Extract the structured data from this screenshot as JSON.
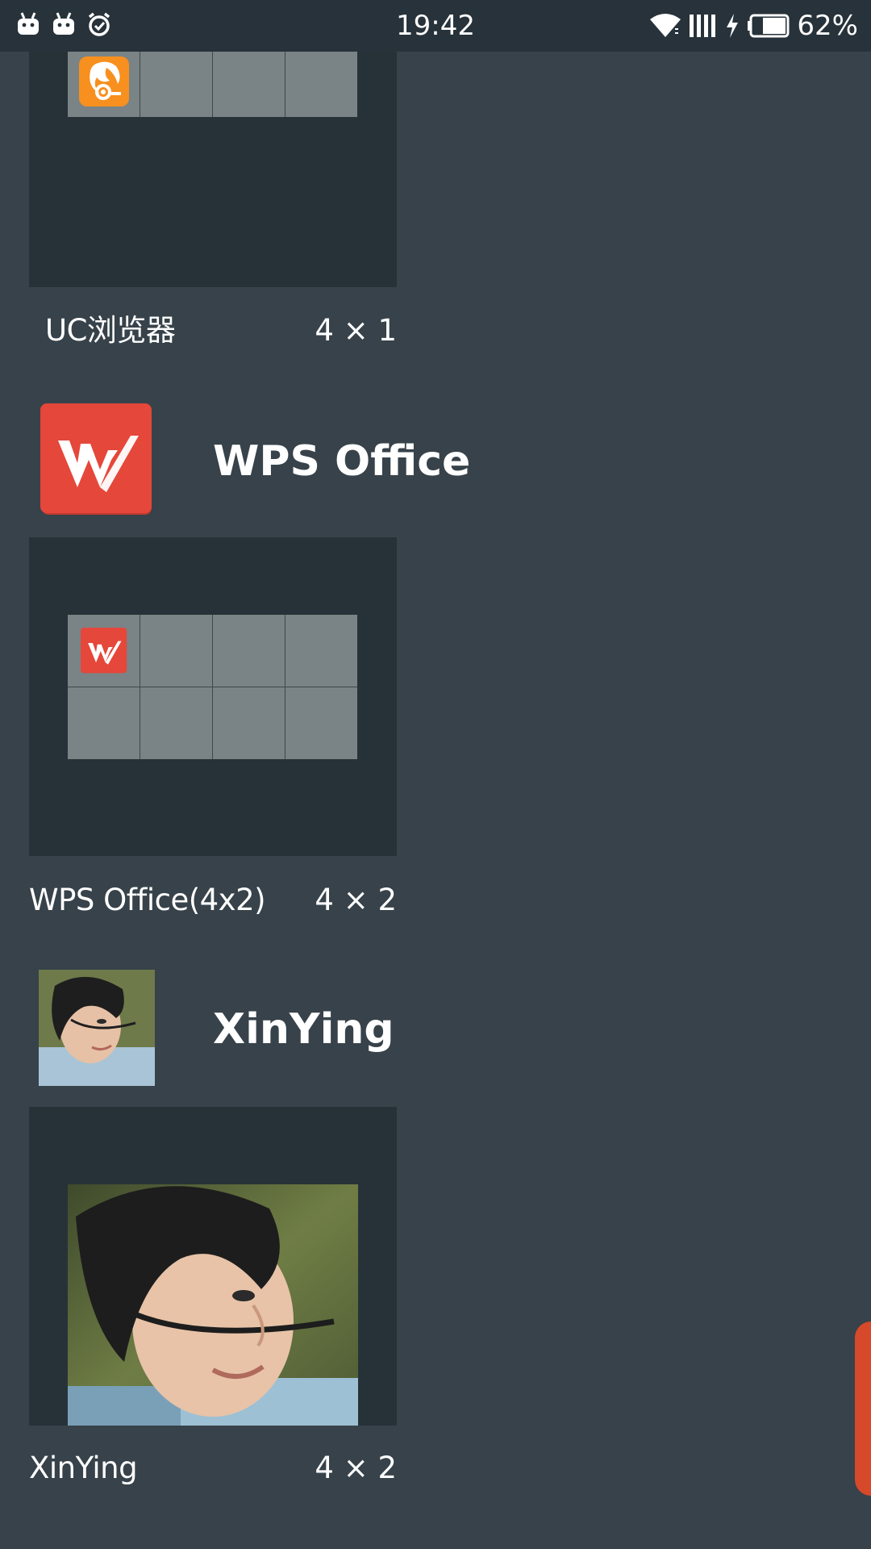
{
  "status_bar": {
    "time": "19:42",
    "battery": "62%",
    "left_icons": [
      "android-icon",
      "android-icon",
      "alarm-icon"
    ],
    "right_icons": [
      "wifi-icon",
      "signal-icon",
      "charging-icon",
      "battery-icon"
    ]
  },
  "widgets": [
    {
      "label": "UC浏览器",
      "size": "4 × 1",
      "icon": "uc-browser-icon"
    },
    {
      "app_title": "WPS Office",
      "app_icon": "wps-office-icon",
      "label": "WPS Office(4x2)",
      "size": "4 × 2"
    },
    {
      "app_title": "XinYing",
      "app_icon": "xinying-photo",
      "label": "XinYing",
      "size": "4 × 2"
    }
  ],
  "colors": {
    "background": "#37424a",
    "preview_bg": "#273238",
    "cell": "#7a8385",
    "accent": "#d6492a",
    "uc_orange": "#f7901e",
    "wps_red": "#e5473a"
  }
}
